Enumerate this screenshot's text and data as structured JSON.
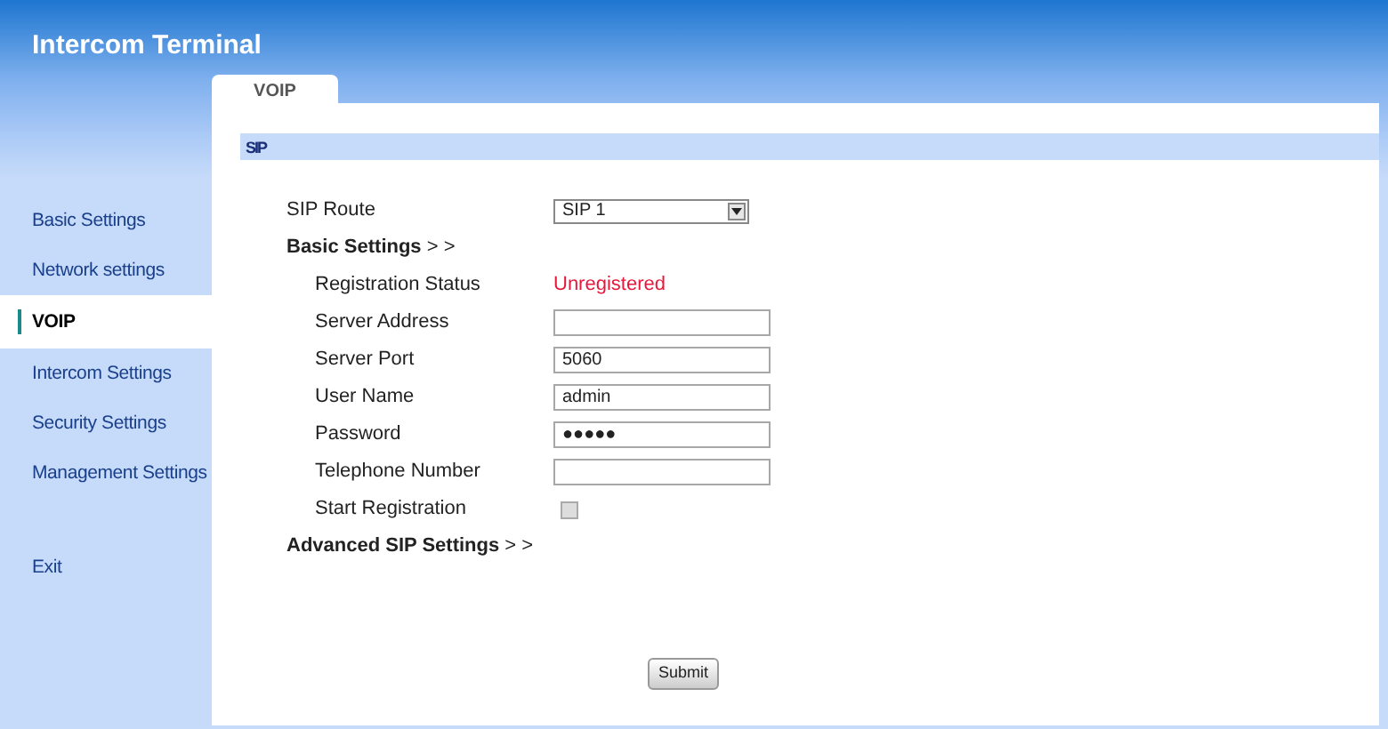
{
  "header": {
    "title": "Intercom Terminal"
  },
  "tabs": [
    {
      "label": "VOIP",
      "selected": true
    }
  ],
  "sidebar": {
    "items": [
      {
        "label": "Basic Settings",
        "selected": false
      },
      {
        "label": "Network settings",
        "selected": false
      },
      {
        "label": "VOIP",
        "selected": true
      },
      {
        "label": "Intercom Settings",
        "selected": false
      },
      {
        "label": "Security Settings",
        "selected": false
      },
      {
        "label": "Management Settings",
        "selected": false
      },
      {
        "label": "Exit",
        "selected": false,
        "kind": "exit"
      }
    ]
  },
  "section_title": "SIP",
  "form": [
    {
      "kind": "select",
      "label": "SIP Route",
      "value": "SIP 1"
    },
    {
      "kind": "heading",
      "label": "**Basic Settings** > >"
    },
    {
      "kind": "status",
      "label": "Registration Status",
      "value": "Unregistered"
    },
    {
      "kind": "text",
      "label": "Server Address"
    },
    {
      "kind": "text",
      "label": "Server Port",
      "value": "5060"
    },
    {
      "kind": "text",
      "label": "User Name",
      "value": "admin"
    },
    {
      "kind": "password",
      "label": "Password",
      "value": "●●●●●"
    },
    {
      "kind": "text",
      "label": "Telephone Number"
    },
    {
      "kind": "checkbox",
      "label": "Start Registration",
      "checked": false
    },
    {
      "kind": "heading",
      "label": "**Advanced SIP Settings** > >"
    }
  ],
  "submit": "Submit"
}
